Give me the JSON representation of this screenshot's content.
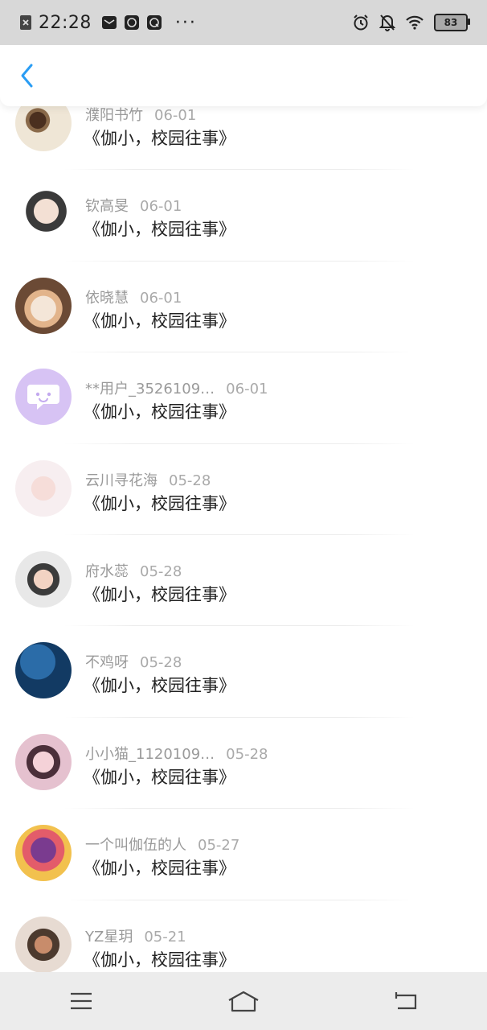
{
  "status_bar": {
    "time": "22:28",
    "battery": "83",
    "icons": [
      "close-badge-icon",
      "message-icon",
      "app-icon-1",
      "app-icon-2",
      "alarm-icon",
      "mute-icon",
      "wifi-icon"
    ],
    "more": "···"
  },
  "header": {
    "back_icon": "chevron-left-icon",
    "accent": "#2a9df4"
  },
  "items": [
    {
      "name": "濮阳书竹",
      "date": "06-01",
      "title": "《伽小，校园往事》"
    },
    {
      "name": "钦高旻",
      "date": "06-01",
      "title": "《伽小，校园往事》"
    },
    {
      "name": "依晓慧",
      "date": "06-01",
      "title": "《伽小，校园往事》"
    },
    {
      "name": "**用户_3526109…",
      "date": "06-01",
      "title": "《伽小，校园往事》"
    },
    {
      "name": "云川寻花海",
      "date": "05-28",
      "title": "《伽小，校园往事》"
    },
    {
      "name": "府水蕊",
      "date": "05-28",
      "title": "《伽小，校园往事》"
    },
    {
      "name": "不鸡呀",
      "date": "05-28",
      "title": "《伽小，校园往事》"
    },
    {
      "name": "小小猫_1120109…",
      "date": "05-28",
      "title": "《伽小，校园往事》"
    },
    {
      "name": "一个叫伽伍的人",
      "date": "05-27",
      "title": "《伽小，校园往事》"
    },
    {
      "name": "YZ星玥",
      "date": "05-21",
      "title": "《伽小，校园往事》"
    }
  ],
  "bottom_nav": {
    "icons": [
      "menu-icon",
      "home-icon",
      "back-icon"
    ]
  }
}
